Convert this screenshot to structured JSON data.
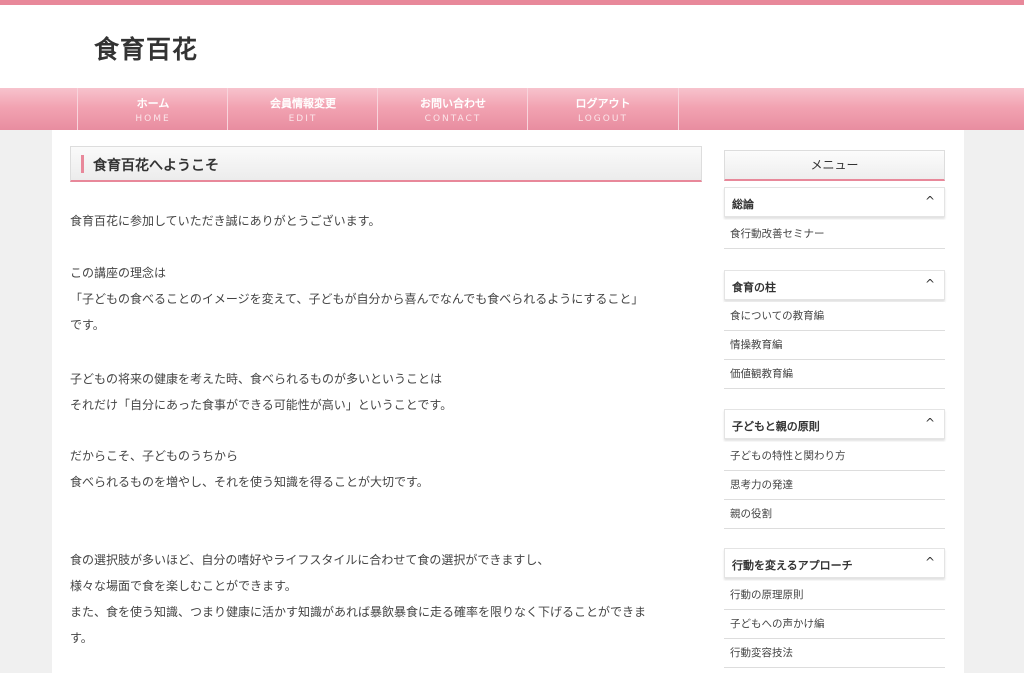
{
  "site": {
    "title": "食育百花"
  },
  "nav": [
    {
      "label": "ホーム",
      "sub": "HOME"
    },
    {
      "label": "会員情報変更",
      "sub": "EDIT"
    },
    {
      "label": "お問い合わせ",
      "sub": "CONTACT"
    },
    {
      "label": "ログアウト",
      "sub": "LOGOUT"
    }
  ],
  "main": {
    "heading": "食育百花へようこそ",
    "lines": [
      "食育百花に参加していただき誠にありがとうございます。",
      "この講座の理念は",
      "「子どもの食べることのイメージを変えて、子どもが自分から喜んでなんでも食べられるようにすること」",
      "です。",
      "子どもの将来の健康を考えた時、食べられるものが多いということは",
      "それだけ「自分にあった食事ができる可能性が高い」ということです。",
      "だからこそ、子どものうちから",
      "食べられるものを増やし、それを使う知識を得ることが大切です。",
      "食の選択肢が多いほど、自分の嗜好やライフスタイルに合わせて食の選択ができますし、",
      "様々な場面で食を楽しむことができます。",
      "また、食を使う知識、つまり健康に活かす知識があれば暴飲暴食に走る確率を限りなく下げることができま",
      "す。"
    ]
  },
  "sidebar": {
    "title": "メニュー",
    "caret": "^",
    "sections": [
      {
        "label": "総論",
        "items": [
          "食行動改善セミナー"
        ]
      },
      {
        "label": "食育の柱",
        "items": [
          "食についての教育編",
          "情操教育編",
          "価値観教育編"
        ]
      },
      {
        "label": "子どもと親の原則",
        "items": [
          "子どもの特性と関わり方",
          "思考力の発達",
          "親の役割"
        ]
      },
      {
        "label": "行動を変えるアプローチ",
        "items": [
          "行動の原理原則",
          "子どもへの声かけ編",
          "行動変容技法"
        ]
      }
    ]
  }
}
